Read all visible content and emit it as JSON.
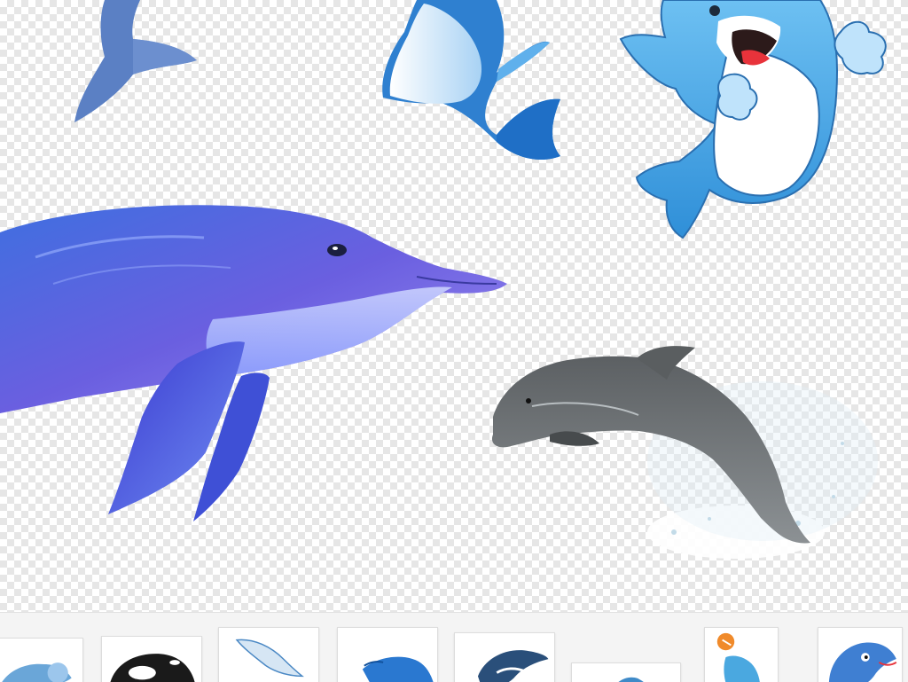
{
  "canvas": {
    "background": "transparency-checkerboard",
    "checker_colors": [
      "#ffffff",
      "#e6e6e6"
    ]
  },
  "figures": [
    {
      "name": "partial-tail-dolphin",
      "style": "clipart",
      "color": "#5b80c4"
    },
    {
      "name": "white-belly-cartoon-dolphin",
      "style": "clipart",
      "color": "#3a90d8"
    },
    {
      "name": "thumbs-up-cartoon-dolphin",
      "style": "cartoon",
      "color": "#4aa4e8"
    },
    {
      "name": "purple-realistic-dolphin",
      "style": "painted",
      "color": "#5a56d8"
    },
    {
      "name": "leaping-grey-dolphin",
      "style": "photo",
      "color": "#6e7376"
    }
  ],
  "thumbnails": [
    {
      "name": "thumb-blue-dolphin-partial",
      "color": "#6aa6d8"
    },
    {
      "name": "thumb-orca",
      "color": "#1a1a1a"
    },
    {
      "name": "thumb-sketch-dolphin",
      "color": "#4a88c4"
    },
    {
      "name": "thumb-blue-dolphin-swimming",
      "color": "#2a78d0"
    },
    {
      "name": "thumb-orca-jumping",
      "color": "#2a4f7a"
    },
    {
      "name": "thumb-small-dolphin",
      "color": "#3f8ac8"
    },
    {
      "name": "thumb-dolphin-with-ball",
      "color": "#4aa8e0"
    },
    {
      "name": "thumb-cartoon-dolphin",
      "color": "#3f7fd2"
    }
  ]
}
